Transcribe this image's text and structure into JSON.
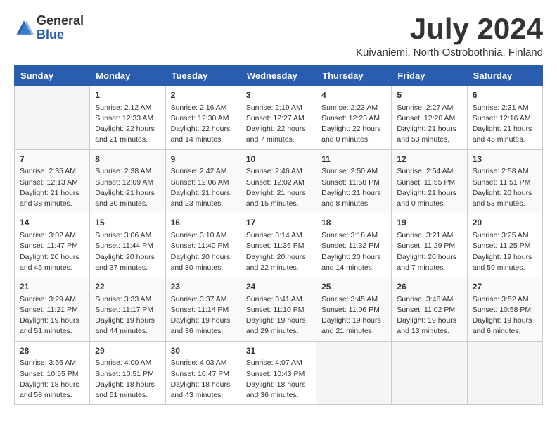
{
  "header": {
    "logo": {
      "general": "General",
      "blue": "Blue"
    },
    "title": "July 2024",
    "location": "Kuivaniemi, North Ostrobothnia, Finland"
  },
  "calendar": {
    "days_of_week": [
      "Sunday",
      "Monday",
      "Tuesday",
      "Wednesday",
      "Thursday",
      "Friday",
      "Saturday"
    ],
    "weeks": [
      [
        {
          "day": "",
          "info": ""
        },
        {
          "day": "1",
          "info": "Sunrise: 2:12 AM\nSunset: 12:33 AM\nDaylight: 22 hours\nand 21 minutes."
        },
        {
          "day": "2",
          "info": "Sunrise: 2:16 AM\nSunset: 12:30 AM\nDaylight: 22 hours\nand 14 minutes."
        },
        {
          "day": "3",
          "info": "Sunrise: 2:19 AM\nSunset: 12:27 AM\nDaylight: 22 hours\nand 7 minutes."
        },
        {
          "day": "4",
          "info": "Sunrise: 2:23 AM\nSunset: 12:23 AM\nDaylight: 22 hours\nand 0 minutes."
        },
        {
          "day": "5",
          "info": "Sunrise: 2:27 AM\nSunset: 12:20 AM\nDaylight: 21 hours\nand 53 minutes."
        },
        {
          "day": "6",
          "info": "Sunrise: 2:31 AM\nSunset: 12:16 AM\nDaylight: 21 hours\nand 45 minutes."
        }
      ],
      [
        {
          "day": "7",
          "info": "Sunrise: 2:35 AM\nSunset: 12:13 AM\nDaylight: 21 hours\nand 38 minutes."
        },
        {
          "day": "8",
          "info": "Sunrise: 2:38 AM\nSunset: 12:09 AM\nDaylight: 21 hours\nand 30 minutes."
        },
        {
          "day": "9",
          "info": "Sunrise: 2:42 AM\nSunset: 12:06 AM\nDaylight: 21 hours\nand 23 minutes."
        },
        {
          "day": "10",
          "info": "Sunrise: 2:46 AM\nSunset: 12:02 AM\nDaylight: 21 hours\nand 15 minutes."
        },
        {
          "day": "11",
          "info": "Sunrise: 2:50 AM\nSunset: 11:58 PM\nDaylight: 21 hours\nand 8 minutes."
        },
        {
          "day": "12",
          "info": "Sunrise: 2:54 AM\nSunset: 11:55 PM\nDaylight: 21 hours\nand 0 minutes."
        },
        {
          "day": "13",
          "info": "Sunrise: 2:58 AM\nSunset: 11:51 PM\nDaylight: 20 hours\nand 53 minutes."
        }
      ],
      [
        {
          "day": "14",
          "info": "Sunrise: 3:02 AM\nSunset: 11:47 PM\nDaylight: 20 hours\nand 45 minutes."
        },
        {
          "day": "15",
          "info": "Sunrise: 3:06 AM\nSunset: 11:44 PM\nDaylight: 20 hours\nand 37 minutes."
        },
        {
          "day": "16",
          "info": "Sunrise: 3:10 AM\nSunset: 11:40 PM\nDaylight: 20 hours\nand 30 minutes."
        },
        {
          "day": "17",
          "info": "Sunrise: 3:14 AM\nSunset: 11:36 PM\nDaylight: 20 hours\nand 22 minutes."
        },
        {
          "day": "18",
          "info": "Sunrise: 3:18 AM\nSunset: 11:32 PM\nDaylight: 20 hours\nand 14 minutes."
        },
        {
          "day": "19",
          "info": "Sunrise: 3:21 AM\nSunset: 11:29 PM\nDaylight: 20 hours\nand 7 minutes."
        },
        {
          "day": "20",
          "info": "Sunrise: 3:25 AM\nSunset: 11:25 PM\nDaylight: 19 hours\nand 59 minutes."
        }
      ],
      [
        {
          "day": "21",
          "info": "Sunrise: 3:29 AM\nSunset: 11:21 PM\nDaylight: 19 hours\nand 51 minutes."
        },
        {
          "day": "22",
          "info": "Sunrise: 3:33 AM\nSunset: 11:17 PM\nDaylight: 19 hours\nand 44 minutes."
        },
        {
          "day": "23",
          "info": "Sunrise: 3:37 AM\nSunset: 11:14 PM\nDaylight: 19 hours\nand 36 minutes."
        },
        {
          "day": "24",
          "info": "Sunrise: 3:41 AM\nSunset: 11:10 PM\nDaylight: 19 hours\nand 29 minutes."
        },
        {
          "day": "25",
          "info": "Sunrise: 3:45 AM\nSunset: 11:06 PM\nDaylight: 19 hours\nand 21 minutes."
        },
        {
          "day": "26",
          "info": "Sunrise: 3:48 AM\nSunset: 11:02 PM\nDaylight: 19 hours\nand 13 minutes."
        },
        {
          "day": "27",
          "info": "Sunrise: 3:52 AM\nSunset: 10:58 PM\nDaylight: 19 hours\nand 6 minutes."
        }
      ],
      [
        {
          "day": "28",
          "info": "Sunrise: 3:56 AM\nSunset: 10:55 PM\nDaylight: 18 hours\nand 58 minutes."
        },
        {
          "day": "29",
          "info": "Sunrise: 4:00 AM\nSunset: 10:51 PM\nDaylight: 18 hours\nand 51 minutes."
        },
        {
          "day": "30",
          "info": "Sunrise: 4:03 AM\nSunset: 10:47 PM\nDaylight: 18 hours\nand 43 minutes."
        },
        {
          "day": "31",
          "info": "Sunrise: 4:07 AM\nSunset: 10:43 PM\nDaylight: 18 hours\nand 36 minutes."
        },
        {
          "day": "",
          "info": ""
        },
        {
          "day": "",
          "info": ""
        },
        {
          "day": "",
          "info": ""
        }
      ]
    ]
  }
}
